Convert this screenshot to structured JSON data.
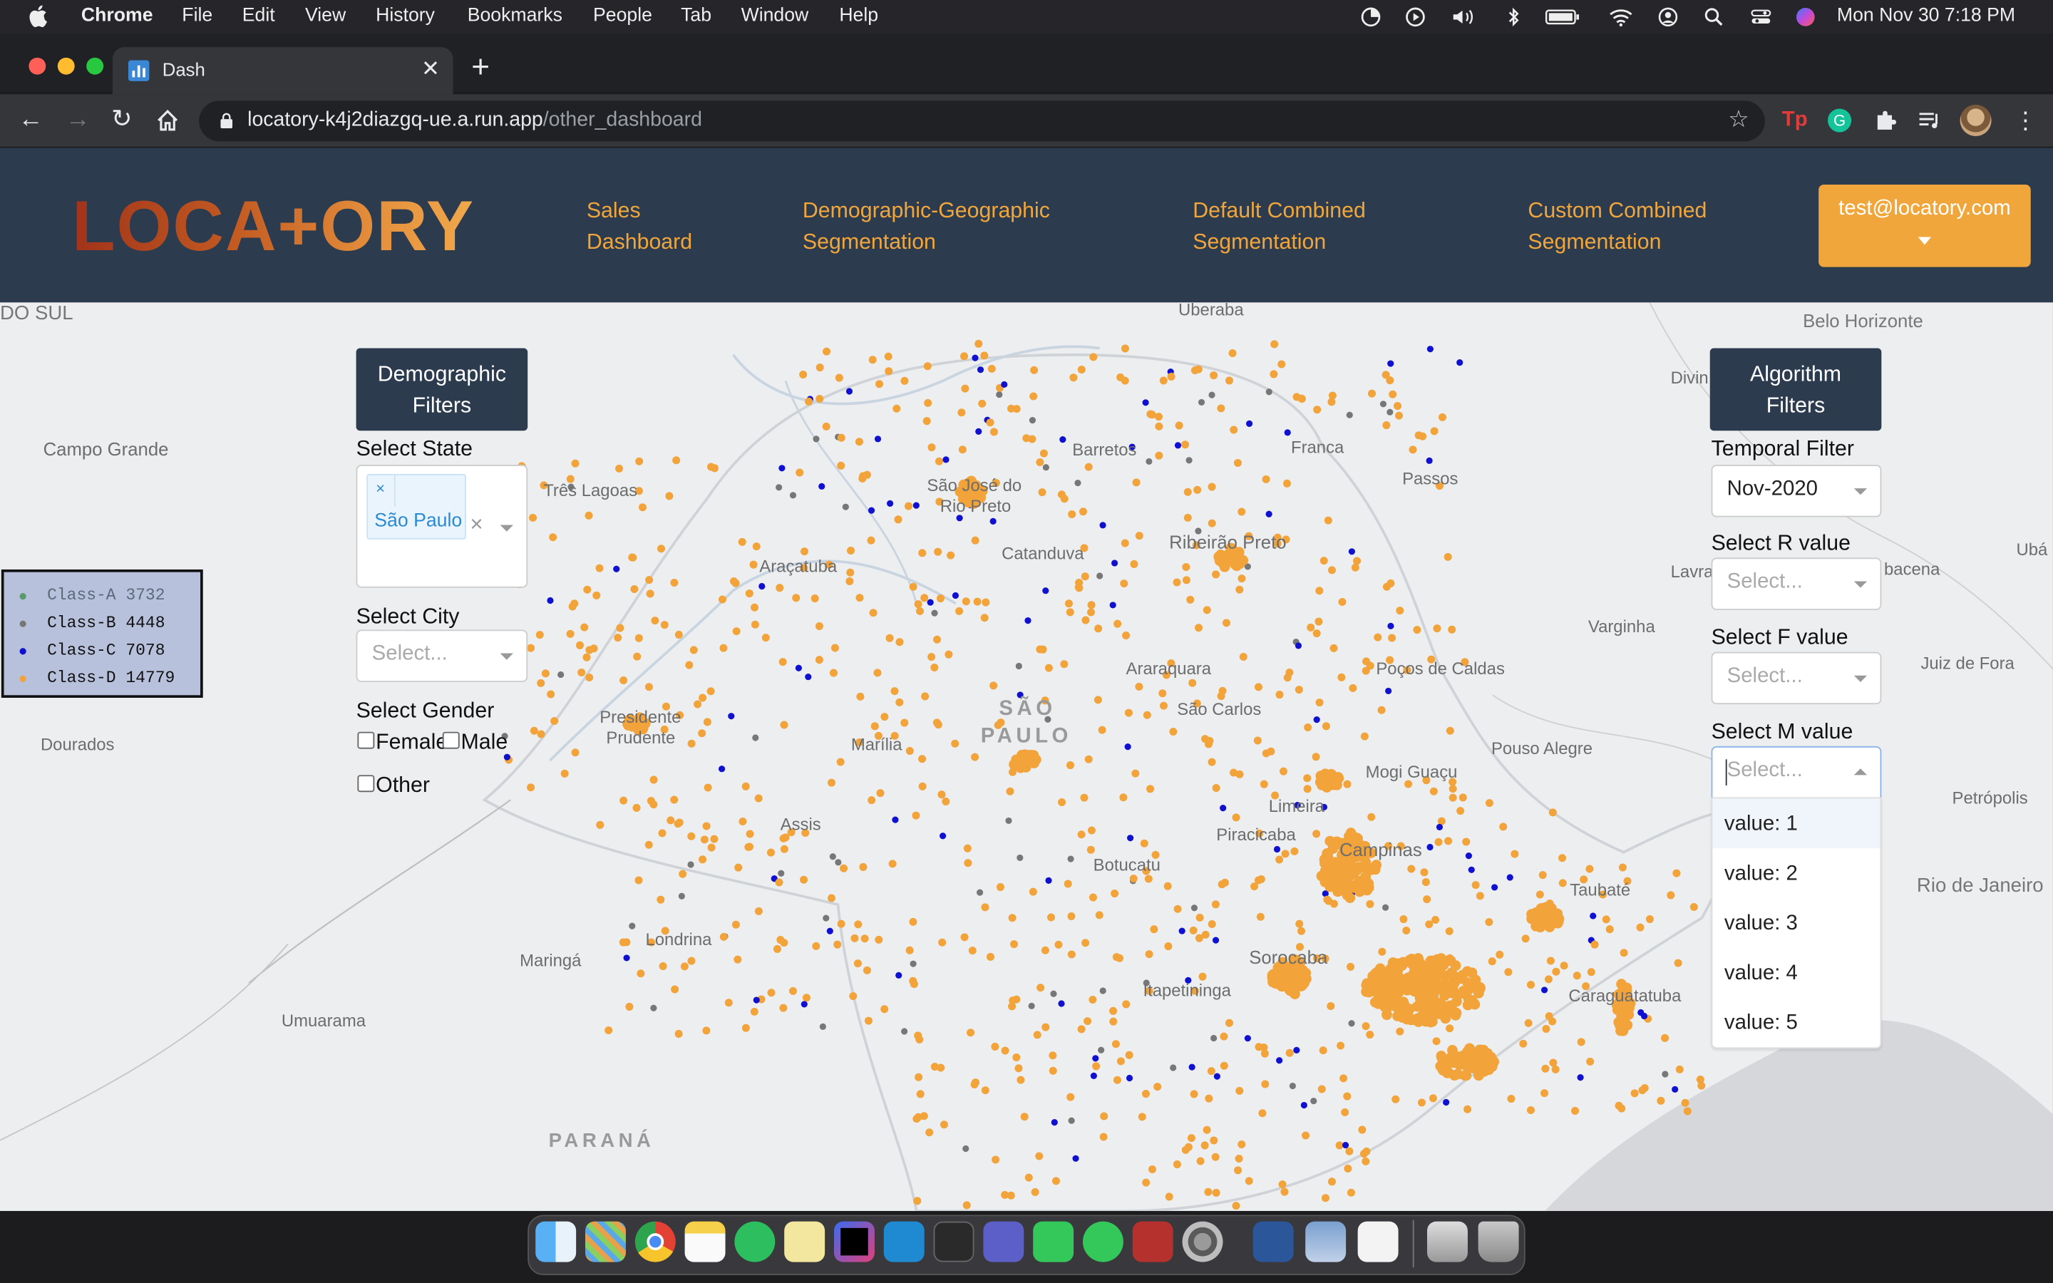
{
  "menubar": {
    "app": "Chrome",
    "items": [
      "File",
      "Edit",
      "View",
      "History",
      "Bookmarks",
      "People",
      "Tab",
      "Window",
      "Help"
    ],
    "clock": "Mon Nov 30  7:18 PM"
  },
  "browser": {
    "tab_title": "Dash",
    "url_host": "locatory-k4j2diazgq-ue.a.run.app",
    "url_path": "/other_dashboard"
  },
  "app": {
    "logo": "LOCA+ORY",
    "nav": [
      {
        "line1": "Sales",
        "line2": "Dashboard"
      },
      {
        "line1": "Demographic-Geographic",
        "line2": "Segmentation"
      },
      {
        "line1": "Default Combined",
        "line2": "Segmentation"
      },
      {
        "line1": "Custom Combined",
        "line2": "Segmentation"
      }
    ],
    "user_email": "test@locatory.com"
  },
  "map": {
    "labels": {
      "do_sul": "DO SUL",
      "uberaba": "Uberaba",
      "belo_horizonte": "Belo Horizonte",
      "campo_grande": "Campo Grande",
      "divin": "Divin",
      "barretos": "Barretos",
      "franca": "Franca",
      "tres_lagoas": "Três Lagoas",
      "sao_jose": "São José do",
      "rio_preto": "Rio Preto",
      "passos": "Passos",
      "ribeirao_preto": "Ribeirão Preto",
      "catanduva": "Catanduva",
      "aracatuba": "Araçatuba",
      "lavra": "Lavra",
      "bacena": "bacena",
      "uba": "Ubá",
      "varginha": "Varginha",
      "araraquara": "Araraquara",
      "pocos": "Poços de Caldas",
      "juiz": "Juiz de Fora",
      "presidente": "Presidente",
      "prudente": "Prudente",
      "sao": "SÃO",
      "paulo_big": "PAULO",
      "sao_carlos": "São Carlos",
      "marilia": "Marília",
      "dourados": "Dourados",
      "mogi": "Mogi Guaçu",
      "pouso": "Pouso Alegre",
      "petropolis": "Petrópolis",
      "limeira": "Limeira",
      "assis": "Assis",
      "piracicaba": "Piracicaba",
      "campinas": "Campinas",
      "botucatu": "Botucatu",
      "taubate": "Taubaté",
      "rio": "Rio de Janeiro",
      "londrina": "Londrina",
      "maringa": "Maringá",
      "sorocaba": "Sorocaba",
      "itapetininga": "Itapetininga",
      "caragua": "Caraguatatuba",
      "umuarama": "Umuarama",
      "parana": "PARANÁ"
    },
    "legend": [
      {
        "name": "Class-A",
        "count": "3732",
        "color": "#5a9a6a"
      },
      {
        "name": "Class-B",
        "count": "4448",
        "color": "#777777"
      },
      {
        "name": "Class-C",
        "count": "7078",
        "color": "#1010d0"
      },
      {
        "name": "Class-D",
        "count": "14779",
        "color": "#f2a33a"
      }
    ]
  },
  "demographic": {
    "title_l1": "Demographic",
    "title_l2": "Filters",
    "state_label": "Select State",
    "state_chip": "São Paulo",
    "chip_remove": "×",
    "clear": "×",
    "city_label": "Select City",
    "city_placeholder": "Select...",
    "gender_label": "Select Gender",
    "genders": [
      "Female",
      "Male",
      "Other"
    ]
  },
  "algorithm": {
    "title_l1": "Algorithm",
    "title_l2": "Filters",
    "temporal_label": "Temporal Filter",
    "temporal_value": "Nov-2020",
    "r_label": "Select R value",
    "f_label": "Select F value",
    "m_label": "Select M value",
    "placeholder": "Select...",
    "m_options": [
      "value: 1",
      "value: 2",
      "value: 3",
      "value: 4",
      "value: 5"
    ]
  }
}
